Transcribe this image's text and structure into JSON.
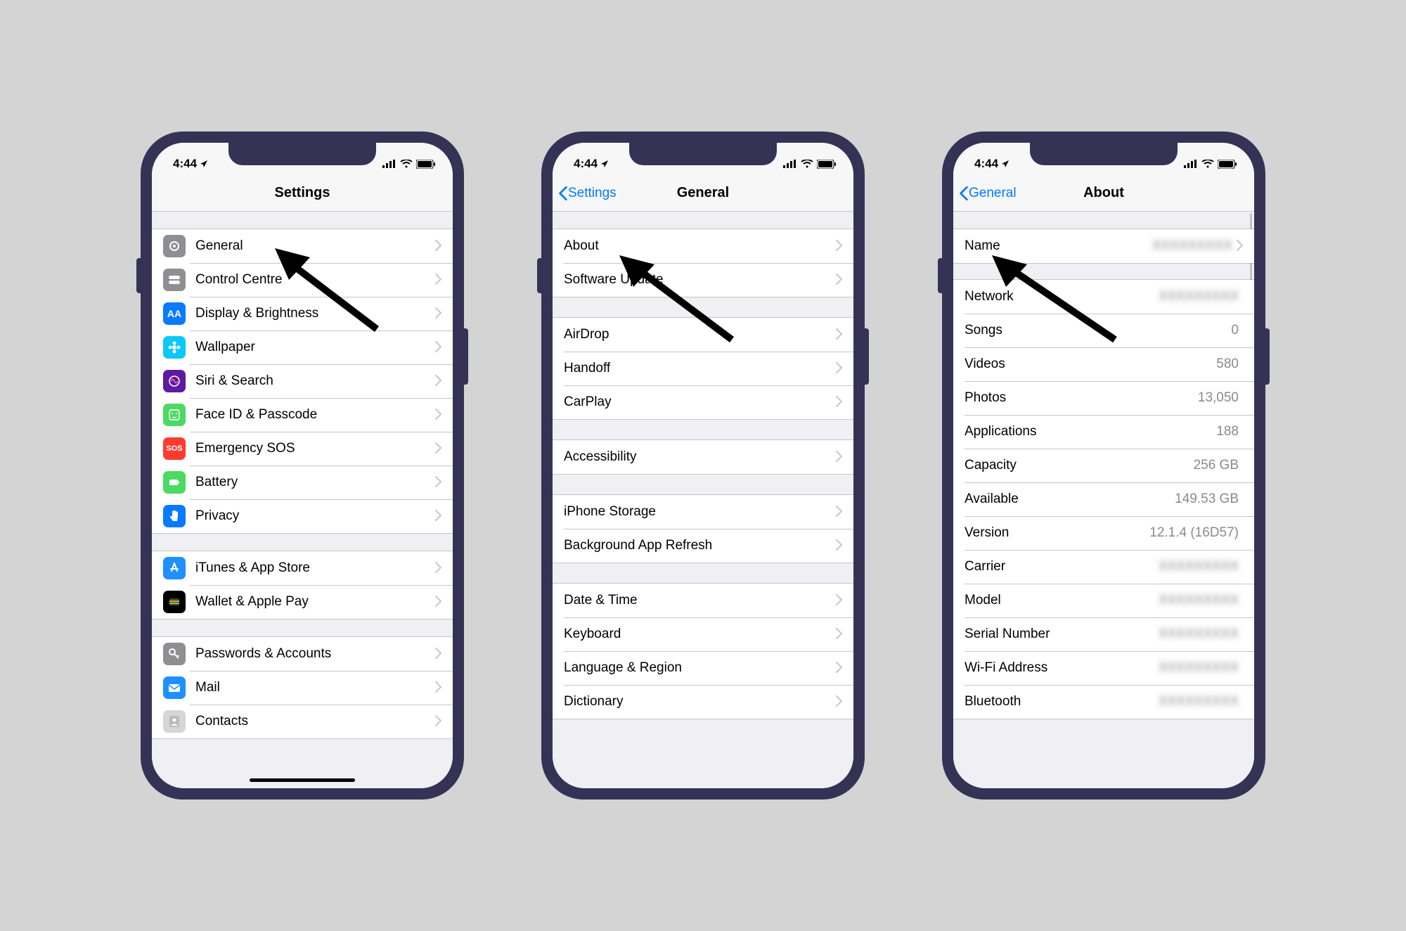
{
  "status": {
    "time": "4:44",
    "loc_icon": "location-arrow"
  },
  "phone1": {
    "title": "Settings",
    "groups": [
      [
        {
          "icon": "gear",
          "bg": "#8e8e93",
          "label": "General"
        },
        {
          "icon": "toggles",
          "bg": "#8e8e93",
          "label": "Control Centre"
        },
        {
          "icon": "AA",
          "bg": "#0a7aff",
          "label": "Display & Brightness",
          "textIcon": true
        },
        {
          "icon": "flower",
          "bg": "#0ac8fa",
          "label": "Wallpaper"
        },
        {
          "icon": "siri",
          "bg": "#5e1b9e",
          "label": "Siri & Search"
        },
        {
          "icon": "face",
          "bg": "#4cd964",
          "label": "Face ID & Passcode"
        },
        {
          "icon": "SOS",
          "bg": "#ff3b30",
          "label": "Emergency SOS",
          "textIcon": true
        },
        {
          "icon": "battery",
          "bg": "#4cd964",
          "label": "Battery"
        },
        {
          "icon": "hand",
          "bg": "#0a7aff",
          "label": "Privacy"
        }
      ],
      [
        {
          "icon": "appstore",
          "bg": "#1e90ff",
          "label": "iTunes & App Store"
        },
        {
          "icon": "wallet",
          "bg": "#000",
          "label": "Wallet & Apple Pay"
        }
      ],
      [
        {
          "icon": "key",
          "bg": "#8e8e93",
          "label": "Passwords & Accounts"
        },
        {
          "icon": "mail",
          "bg": "#1e90ff",
          "label": "Mail"
        },
        {
          "icon": "contacts",
          "bg": "#d6d6d6",
          "label": "Contacts"
        }
      ]
    ]
  },
  "phone2": {
    "back": "Settings",
    "title": "General",
    "groups": [
      [
        {
          "label": "About"
        },
        {
          "label": "Software Update"
        }
      ],
      [
        {
          "label": "AirDrop"
        },
        {
          "label": "Handoff"
        },
        {
          "label": "CarPlay"
        }
      ],
      [
        {
          "label": "Accessibility"
        }
      ],
      [
        {
          "label": "iPhone Storage"
        },
        {
          "label": "Background App Refresh"
        }
      ],
      [
        {
          "label": "Date & Time"
        },
        {
          "label": "Keyboard"
        },
        {
          "label": "Language & Region"
        },
        {
          "label": "Dictionary"
        }
      ]
    ]
  },
  "phone3": {
    "back": "General",
    "title": "About",
    "groups": [
      [
        {
          "label": "Name",
          "value": "",
          "blur": true,
          "chevron": true
        }
      ],
      [
        {
          "label": "Network",
          "value": "",
          "blur": true
        },
        {
          "label": "Songs",
          "value": "0"
        },
        {
          "label": "Videos",
          "value": "580"
        },
        {
          "label": "Photos",
          "value": "13,050"
        },
        {
          "label": "Applications",
          "value": "188"
        },
        {
          "label": "Capacity",
          "value": "256 GB"
        },
        {
          "label": "Available",
          "value": "149.53 GB"
        },
        {
          "label": "Version",
          "value": "12.1.4 (16D57)"
        },
        {
          "label": "Carrier",
          "value": "",
          "blur": true
        },
        {
          "label": "Model",
          "value": "",
          "blur": true
        },
        {
          "label": "Serial Number",
          "value": "",
          "blur": true
        },
        {
          "label": "Wi-Fi Address",
          "value": "",
          "blur": true
        },
        {
          "label": "Bluetooth",
          "value": "",
          "blur": true
        }
      ]
    ]
  }
}
